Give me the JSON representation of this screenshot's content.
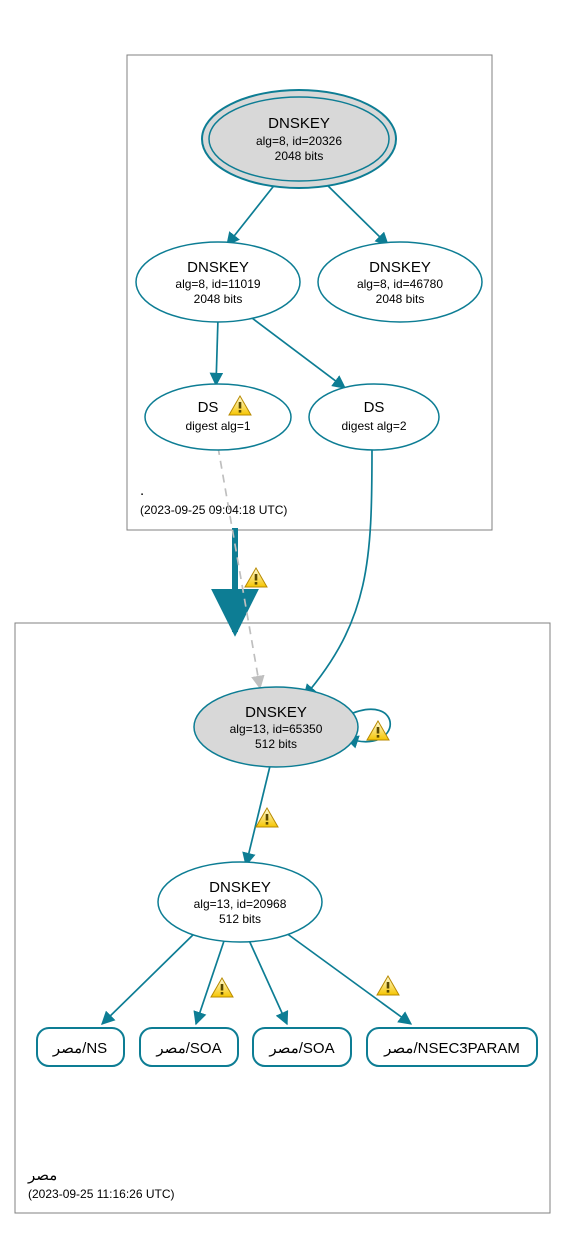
{
  "zones": {
    "root": {
      "name": ".",
      "timestamp": "(2023-09-25 09:04:18 UTC)"
    },
    "child": {
      "name": "مصر",
      "timestamp": "(2023-09-25 11:16:26 UTC)"
    }
  },
  "nodes": {
    "root_ksk": {
      "title": "DNSKEY",
      "line2": "alg=8, id=20326",
      "line3": "2048 bits"
    },
    "root_zsk1": {
      "title": "DNSKEY",
      "line2": "alg=8, id=11019",
      "line3": "2048 bits"
    },
    "root_zsk2": {
      "title": "DNSKEY",
      "line2": "alg=8, id=46780",
      "line3": "2048 bits"
    },
    "ds1": {
      "title": "DS",
      "line2": "digest alg=1"
    },
    "ds2": {
      "title": "DS",
      "line2": "digest alg=2"
    },
    "child_ksk": {
      "title": "DNSKEY",
      "line2": "alg=13, id=65350",
      "line3": "512 bits"
    },
    "child_zsk": {
      "title": "DNSKEY",
      "line2": "alg=13, id=20968",
      "line3": "512 bits"
    },
    "rr_ns": {
      "label": "مصر/NS"
    },
    "rr_soa1": {
      "label": "مصر/SOA"
    },
    "rr_soa2": {
      "label": "مصر/SOA"
    },
    "rr_nsec3": {
      "label": "مصر/NSEC3PARAM"
    }
  }
}
